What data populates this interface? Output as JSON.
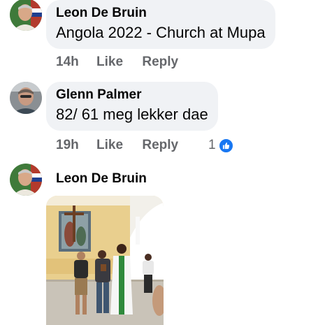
{
  "comments": [
    {
      "author": "Leon De Bruin",
      "text": "Angola 2022 - Church at Mupa",
      "time": "14h",
      "like_label": "Like",
      "reply_label": "Reply"
    },
    {
      "author": "Glenn Palmer",
      "text": "82/ 61 meg lekker dae",
      "time": "19h",
      "like_label": "Like",
      "reply_label": "Reply",
      "reaction_count": "1",
      "reaction_icon": "thumbs-up-icon"
    },
    {
      "author": "Leon De Bruin",
      "attachment": "photo"
    }
  ],
  "colors": {
    "bubble": "#f0f2f5",
    "meta_text": "#65676b",
    "like_blue": "#1877f2"
  }
}
